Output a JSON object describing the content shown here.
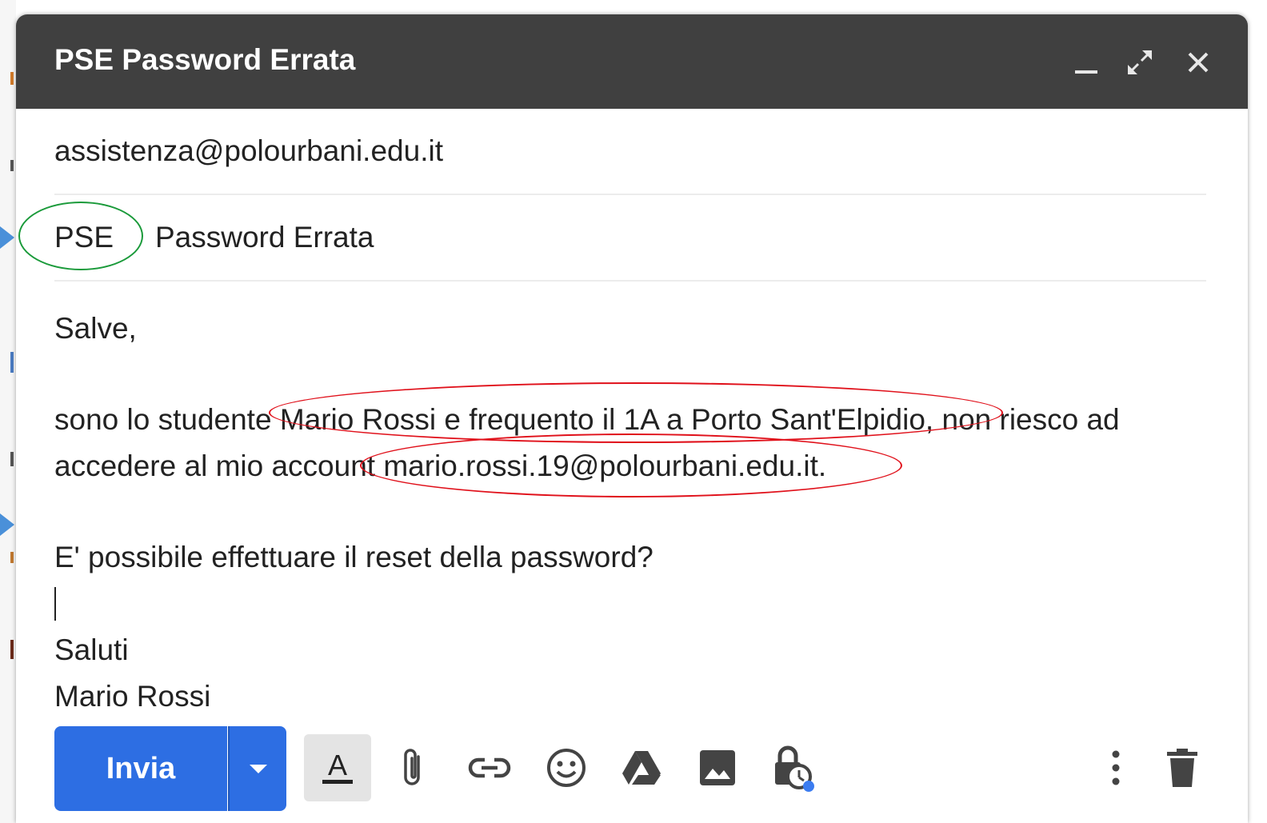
{
  "window": {
    "title": "PSE Password Errata",
    "minimize_label": "_",
    "expand_label": "⤢",
    "close_label": "✕"
  },
  "compose": {
    "to": "assistenza@polourbani.edu.it",
    "subject_prefix": "PSE",
    "subject_rest": "Password Errata",
    "body": {
      "greeting": "Salve,",
      "line1": "sono lo studente Mario Rossi e frequento il 1A a Porto Sant'Elpidio, non riesco ad",
      "line2": "accedere al mio account mario.rossi.19@polourbani.edu.it.",
      "question": "E' possibile effettuare il reset della password?",
      "closing": "Saluti",
      "signature": "Mario Rossi"
    }
  },
  "toolbar": {
    "send_label": "Invia",
    "icons": [
      "format-text-icon",
      "attach-icon",
      "link-icon",
      "emoji-icon",
      "drive-icon",
      "photo-icon",
      "confidential-icon",
      "more-options-icon",
      "delete-icon"
    ]
  },
  "colors": {
    "titlebar": "#404040",
    "send_button": "#2d6ee3",
    "annotation_red": "#e0101a",
    "annotation_green": "#1a9a3a",
    "side_arrow": "#4a90d9"
  }
}
